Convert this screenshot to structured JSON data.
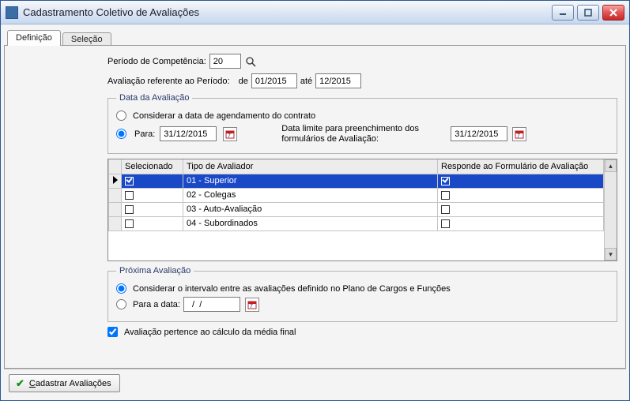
{
  "window": {
    "title": "Cadastramento Coletivo de Avaliações"
  },
  "tabs": {
    "definicao": "Definição",
    "selecao": "Seleção"
  },
  "periodo": {
    "label": "Período de Competência:",
    "value": "20"
  },
  "referente": {
    "label": "Avaliação referente ao Período:",
    "de_label": "de",
    "de_value": "01/2015",
    "ate_label": "até",
    "ate_value": "12/2015"
  },
  "data_avaliacao": {
    "legend": "Data da Avaliação",
    "opt_agendamento": "Considerar a data de agendamento do contrato",
    "opt_para": "Para:",
    "para_value": "31/12/2015",
    "limite_label": "Data limite para preenchimento dos formulários de Avaliação:",
    "limite_value": "31/12/2015"
  },
  "grid": {
    "headers": {
      "selecionado": "Selecionado",
      "tipo": "Tipo de Avaliador",
      "responde": "Responde ao Formulário de Avaliação"
    },
    "rows": [
      {
        "selecionado": true,
        "tipo": "01 - Superior",
        "responde": true
      },
      {
        "selecionado": false,
        "tipo": "02 - Colegas",
        "responde": false
      },
      {
        "selecionado": false,
        "tipo": "03 - Auto-Avaliação",
        "responde": false
      },
      {
        "selecionado": false,
        "tipo": "04 - Subordinados",
        "responde": false
      }
    ]
  },
  "proxima": {
    "legend": "Próxima Avaliação",
    "opt_plano": "Considerar o intervalo entre as avaliações definido no Plano de Cargos e Funções",
    "opt_data": "Para a data:",
    "data_value": "  /  /"
  },
  "media_final": {
    "label": "Avaliação pertence ao cálculo da média final",
    "checked": true
  },
  "footer": {
    "cadastrar": "Cadastrar Avaliações"
  }
}
